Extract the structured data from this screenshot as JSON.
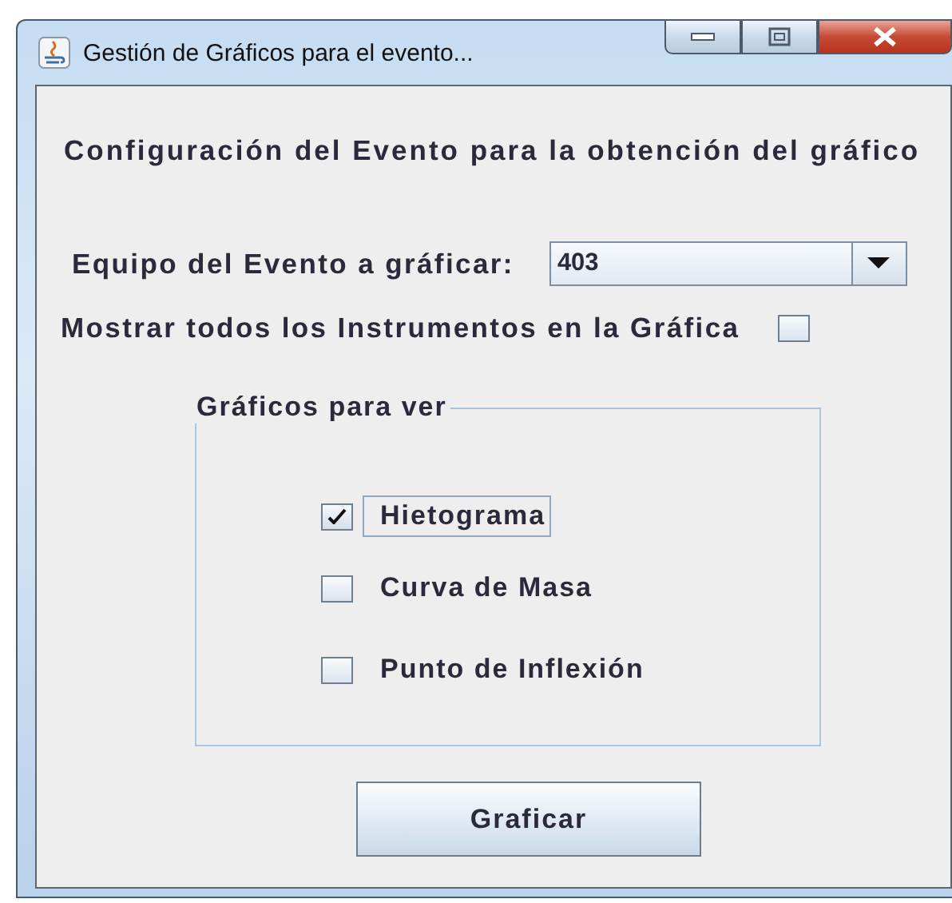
{
  "window": {
    "title": "Gestión de Gráficos para el evento..."
  },
  "heading": "Configuración del Evento para la obtención del gráfico",
  "team": {
    "label": "Equipo del Evento a gráficar:",
    "value": "403"
  },
  "show_all": {
    "label": "Mostrar todos los Instrumentos en la Gráfica",
    "checked": false
  },
  "charts_group": {
    "title": "Gráficos para ver",
    "items": [
      {
        "label": "Hietograma",
        "checked": true,
        "focused": true
      },
      {
        "label": "Curva de Masa",
        "checked": false,
        "focused": false
      },
      {
        "label": "Punto de Inflexión",
        "checked": false,
        "focused": false
      }
    ]
  },
  "buttons": [
    "Graficar"
  ]
}
